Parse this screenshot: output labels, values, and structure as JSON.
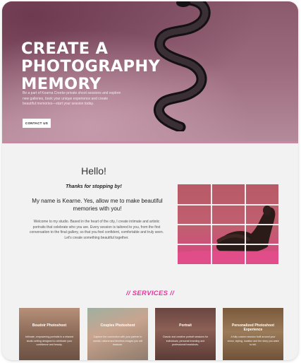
{
  "hero": {
    "title_line1": "CREATE A",
    "title_line2": "PHOTOGRAPHY",
    "title_line3": "MEMORY",
    "subtitle": "Be a part of Kearna Creeke private shoot sessions and explore new galleries, book your unique experience and create beautiful memories—start your session today.",
    "cta_label": "CONTACT US"
  },
  "hello": {
    "title": "Hello!",
    "thanks": "Thanks for stopping by!",
    "intro": "My name is Kearne. Yes, allow me to make beautiful memories with you!",
    "body": "Welcome to my studio. Based in the heart of the city, I create intimate and artistic portraits that celebrate who you are. Every session is tailored to you, from the first conversation to the final gallery, so that you feel confident, comfortable and truly seen. Let's create something beautiful together."
  },
  "services": {
    "title": "// SERVICES //",
    "cards": [
      {
        "title": "Boudoir Photoshoot",
        "text": "Intimate, empowering portraits in a relaxed studio setting designed to celebrate your confidence and beauty."
      },
      {
        "title": "Couples Photoshoot",
        "text": "Capture the connection with your partner in candid, natural and timeless images you will treasure."
      },
      {
        "title": "Portrait",
        "text": "Classic and creative portrait sessions for individuals, personal branding and professional headshots."
      },
      {
        "title": "Personalized Photoshoot Experience",
        "text": "A fully custom session built around your vision, styling, location and the story you want to tell."
      }
    ]
  },
  "colors": {
    "hero_tint": "#9c6a7d",
    "accent_pink": "#e0399a",
    "photo_backdrop": "#c05f70"
  }
}
